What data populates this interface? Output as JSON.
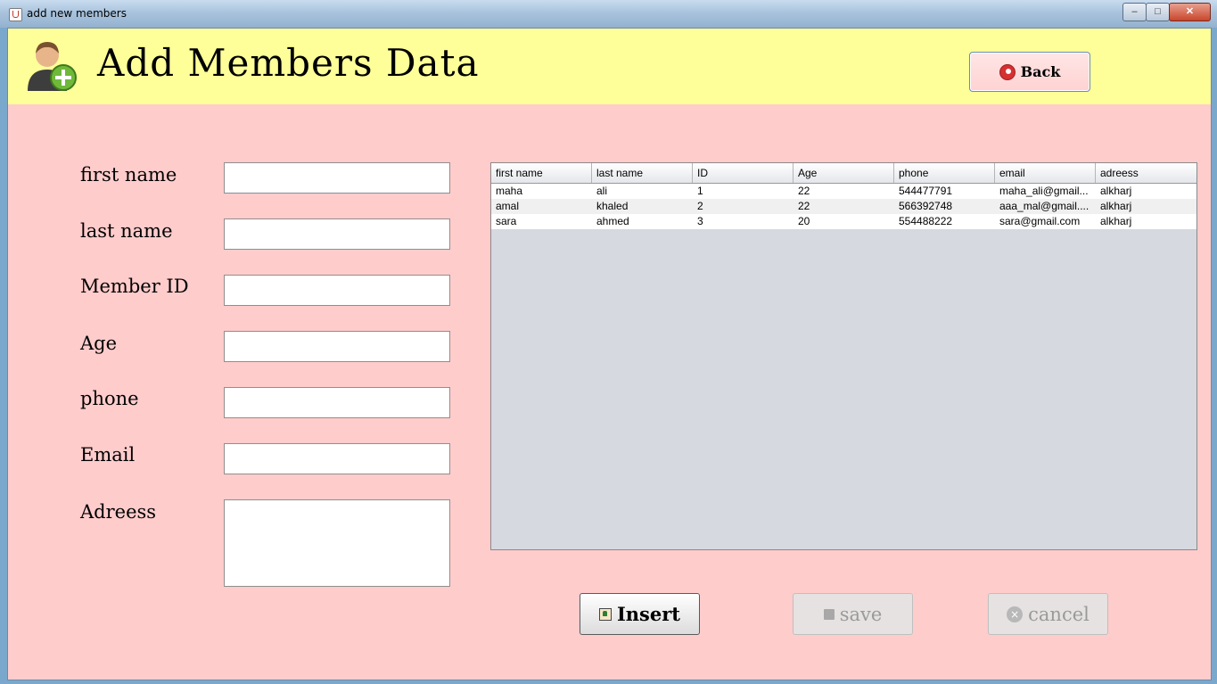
{
  "window": {
    "title": "add new members",
    "min_glyph": "–",
    "max_glyph": "□",
    "close_glyph": "✕"
  },
  "header": {
    "title": "Add Members Data",
    "back_label": "Back"
  },
  "form": {
    "labels": [
      "first name",
      "last name",
      "Member ID",
      "Age",
      "phone",
      "Email",
      "Adreess"
    ],
    "values": [
      "",
      "",
      "",
      "",
      "",
      "",
      ""
    ]
  },
  "table": {
    "columns": [
      "first name",
      "last name",
      "ID",
      "Age",
      "phone",
      "email",
      "adreess"
    ],
    "rows": [
      [
        "maha",
        "ali",
        "1",
        "22",
        "544477791",
        "maha_ali@gmail...",
        "alkharj"
      ],
      [
        "amal",
        "khaled",
        "2",
        "22",
        "566392748",
        "aaa_mal@gmail....",
        "alkharj"
      ],
      [
        "sara",
        "ahmed",
        "3",
        "20",
        "554488222",
        "sara@gmail.com",
        "alkharj"
      ]
    ]
  },
  "buttons": {
    "insert": "Insert",
    "save": "save",
    "cancel": "cancel",
    "cancel_glyph": "×"
  },
  "colors": {
    "header_bg": "#ffff99",
    "frame_bg": "#ffcccc",
    "table_bg": "#d6d9e0"
  }
}
